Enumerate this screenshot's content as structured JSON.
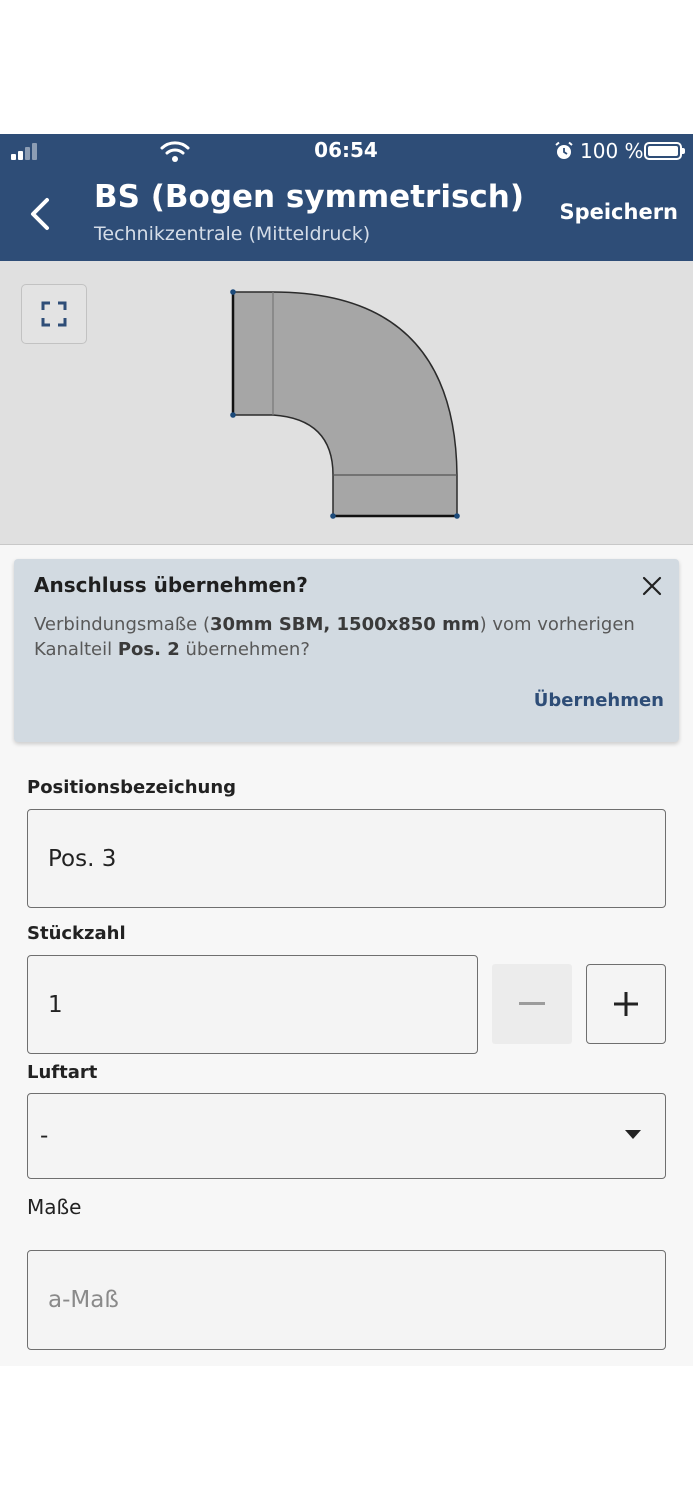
{
  "status_bar": {
    "time": "06:54",
    "battery": "100 %"
  },
  "header": {
    "title": "BS (Bogen symmetrisch)",
    "subtitle": "Technikzentrale (Mitteldruck)",
    "save_label": "Speichern",
    "background_color": "#2e4d77"
  },
  "banner": {
    "title": "Anschluss übernehmen?",
    "message_prefix": "Verbindungsmaße (",
    "message_bold_1": "30mm SBM, 1500x850 mm",
    "message_mid": ") vom vorherigen Kanalteil ",
    "message_bold_2": "Pos. 2",
    "message_suffix": " übernehmen?",
    "action_label": "Übernehmen"
  },
  "form": {
    "position_label": "Positionsbezeichung",
    "position_value": "Pos. 3",
    "quantity_label": "Stückzahl",
    "quantity_value": "1",
    "air_type_label": "Luftart",
    "air_type_value": "-",
    "dimensions_label": "Maße",
    "a_dimension_placeholder": "a-Maß"
  },
  "icons": {
    "back": "chevron-left-icon",
    "expand": "fullscreen-icon",
    "close": "close-icon",
    "minus": "minus-icon",
    "plus": "plus-icon",
    "dropdown": "caret-down-icon"
  }
}
